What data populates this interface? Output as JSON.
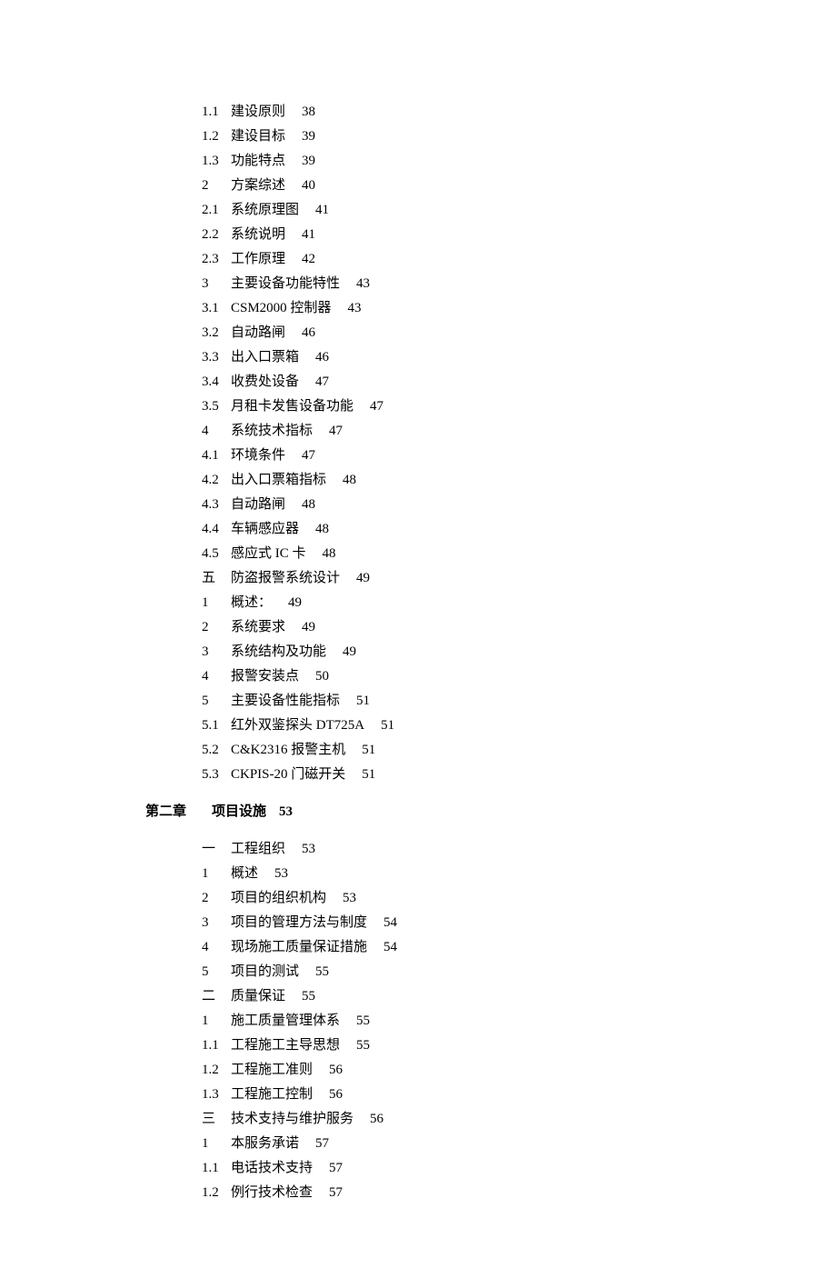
{
  "entries": [
    {
      "type": "item",
      "num": "1.1",
      "title": "建设原则",
      "page": "38"
    },
    {
      "type": "item",
      "num": "1.2",
      "title": "建设目标",
      "page": "39"
    },
    {
      "type": "item",
      "num": "1.3",
      "title": "功能特点",
      "page": "39"
    },
    {
      "type": "item",
      "num": "2",
      "title": "方案综述",
      "page": "40"
    },
    {
      "type": "item",
      "num": "2.1",
      "title": "系统原理图",
      "page": "41"
    },
    {
      "type": "item",
      "num": "2.2",
      "title": "系统说明",
      "page": "41"
    },
    {
      "type": "item",
      "num": "2.3",
      "title": "工作原理",
      "page": "42"
    },
    {
      "type": "item",
      "num": "3",
      "title": "主要设备功能特性",
      "page": "43"
    },
    {
      "type": "item",
      "num": "3.1",
      "title": "CSM2000 控制器",
      "page": "43"
    },
    {
      "type": "item",
      "num": "3.2",
      "title": "自动路闸",
      "page": "46"
    },
    {
      "type": "item",
      "num": "3.3",
      "title": "出入口票箱",
      "page": "46"
    },
    {
      "type": "item",
      "num": "3.4",
      "title": "收费处设备",
      "page": "47"
    },
    {
      "type": "item",
      "num": "3.5",
      "title": "月租卡发售设备功能",
      "page": "47"
    },
    {
      "type": "item",
      "num": "4",
      "title": "系统技术指标",
      "page": "47"
    },
    {
      "type": "item",
      "num": "4.1",
      "title": "环境条件",
      "page": "47"
    },
    {
      "type": "item",
      "num": "4.2",
      "title": "出入口票箱指标",
      "page": "48"
    },
    {
      "type": "item",
      "num": "4.3",
      "title": "自动路闸",
      "page": "48"
    },
    {
      "type": "item",
      "num": "4.4",
      "title": "车辆感应器",
      "page": "48"
    },
    {
      "type": "item",
      "num": "4.5",
      "title": "感应式 IC 卡",
      "page": "48"
    },
    {
      "type": "item",
      "num": "五",
      "title": "防盗报警系统设计",
      "page": "49"
    },
    {
      "type": "item",
      "num": "1",
      "title": "概述：",
      "page": "49"
    },
    {
      "type": "item",
      "num": "2",
      "title": "系统要求",
      "page": "49"
    },
    {
      "type": "item",
      "num": "3",
      "title": "系统结构及功能",
      "page": "49"
    },
    {
      "type": "item",
      "num": "4",
      "title": "报警安装点",
      "page": "50"
    },
    {
      "type": "item",
      "num": "5",
      "title": "主要设备性能指标",
      "page": "51"
    },
    {
      "type": "item",
      "num": "5.1",
      "title": "红外双鉴探头 DT725A",
      "page": "51"
    },
    {
      "type": "item",
      "num": "5.2",
      "title": "C&K2316 报警主机",
      "page": "51"
    },
    {
      "type": "item",
      "num": "5.3",
      "title": "CKPIS-20 门磁开关",
      "page": "51"
    },
    {
      "type": "chapter",
      "label": "第二章",
      "title": "项目设施",
      "page": "53"
    },
    {
      "type": "item",
      "num": "一",
      "title": "工程组织",
      "page": "53"
    },
    {
      "type": "item",
      "num": "1",
      "title": "概述",
      "page": "53"
    },
    {
      "type": "item",
      "num": "2",
      "title": "项目的组织机构",
      "page": "53"
    },
    {
      "type": "item",
      "num": "3",
      "title": "项目的管理方法与制度",
      "page": "54"
    },
    {
      "type": "item",
      "num": "4",
      "title": "现场施工质量保证措施",
      "page": "54"
    },
    {
      "type": "item",
      "num": "5",
      "title": "项目的测试",
      "page": "55"
    },
    {
      "type": "item",
      "num": "二",
      "title": "质量保证",
      "page": "55"
    },
    {
      "type": "item",
      "num": "1",
      "title": "施工质量管理体系",
      "page": "55"
    },
    {
      "type": "item",
      "num": "1.1",
      "title": "工程施工主导思想",
      "page": "55"
    },
    {
      "type": "item",
      "num": "1.2",
      "title": "工程施工准则",
      "page": "56"
    },
    {
      "type": "item",
      "num": "1.3",
      "title": "工程施工控制",
      "page": "56"
    },
    {
      "type": "item",
      "num": "三",
      "title": "技术支持与维护服务",
      "page": "56"
    },
    {
      "type": "item",
      "num": "1",
      "title": "本服务承诺",
      "page": "57"
    },
    {
      "type": "item",
      "num": "1.1",
      "title": "电话技术支持",
      "page": "57"
    },
    {
      "type": "item",
      "num": "1.2",
      "title": "例行技术检查",
      "page": "57"
    }
  ]
}
